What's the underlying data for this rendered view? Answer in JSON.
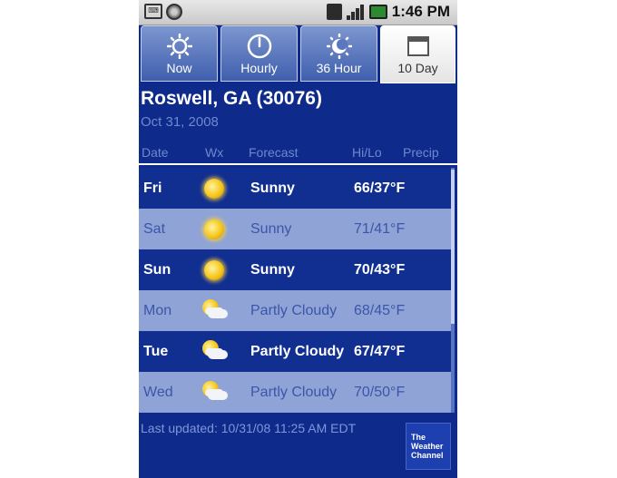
{
  "status_bar": {
    "time": "1:46 PM",
    "icons": [
      "debug-icon",
      "circle-icon",
      "sync-icon",
      "signal-icon",
      "battery-icon"
    ]
  },
  "tabs": [
    {
      "label": "Now",
      "icon": "sun-icon",
      "active": false
    },
    {
      "label": "Hourly",
      "icon": "clock-icon",
      "active": false
    },
    {
      "label": "36 Hour",
      "icon": "sun-moon-icon",
      "active": false
    },
    {
      "label": "10 Day",
      "icon": "calendar-icon",
      "active": true
    }
  ],
  "location": {
    "city": "Roswell, GA (30076)",
    "date": "Oct 31, 2008"
  },
  "columns": {
    "date": "Date",
    "wx": "Wx",
    "forecast": "Forecast",
    "hilo": "Hi/Lo",
    "precip": "Precip"
  },
  "forecast": [
    {
      "day": "Fri",
      "icon": "sunny-icon",
      "forecast": "Sunny",
      "hilo": "66/37°F"
    },
    {
      "day": "Sat",
      "icon": "sunny-icon",
      "forecast": "Sunny",
      "hilo": "71/41°F"
    },
    {
      "day": "Sun",
      "icon": "sunny-icon",
      "forecast": "Sunny",
      "hilo": "70/43°F"
    },
    {
      "day": "Mon",
      "icon": "partly-cloudy-icon",
      "forecast": "Partly Cloudy",
      "hilo": "68/45°F"
    },
    {
      "day": "Tue",
      "icon": "partly-cloudy-icon",
      "forecast": "Partly Cloudy",
      "hilo": "67/47°F"
    },
    {
      "day": "Wed",
      "icon": "partly-cloudy-icon",
      "forecast": "Partly Cloudy",
      "hilo": "70/50°F"
    }
  ],
  "footer": {
    "last_updated": "Last updated: 10/31/08 11:25 AM EDT",
    "logo_lines": [
      "The",
      "Weather",
      "Channel"
    ]
  },
  "colors": {
    "background": "#0e2a8a",
    "row_dark": "#112e91",
    "row_light": "#8fa3d6",
    "muted_text": "#6f88cf"
  }
}
